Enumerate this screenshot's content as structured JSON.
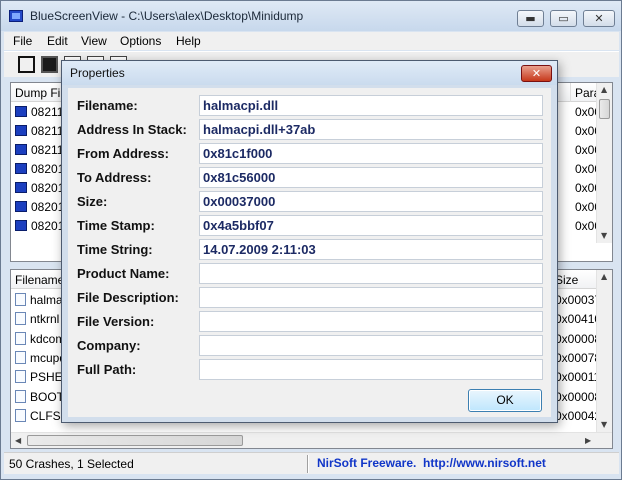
{
  "window": {
    "title": "BlueScreenView  -  C:\\Users\\alex\\Desktop\\Minidump",
    "min_label": "▬",
    "max_label": "▭",
    "close_label": "✕"
  },
  "menu": [
    "File",
    "Edit",
    "View",
    "Options",
    "Help"
  ],
  "upper_list": {
    "headers": [
      "Dump Fil",
      "Para"
    ],
    "rows": [
      {
        "name": "082112",
        "param": "0x00"
      },
      {
        "name": "082112",
        "param": "0x00"
      },
      {
        "name": "082112",
        "param": "0x00"
      },
      {
        "name": "082012",
        "param": "0x00"
      },
      {
        "name": "082012",
        "param": "0x00"
      },
      {
        "name": "082012",
        "param": "0x00"
      },
      {
        "name": "082012",
        "param": "0x00"
      }
    ]
  },
  "lower_list": {
    "headers": [
      "Filename",
      "Size"
    ],
    "rows": [
      {
        "name": "halma",
        "size": "0x000370"
      },
      {
        "name": "ntkrnl",
        "size": "0x00410"
      },
      {
        "name": "kdcom",
        "size": "0x000080"
      },
      {
        "name": "mcupd",
        "size": "0x00078"
      },
      {
        "name": "PSHED",
        "size": "0x00011"
      },
      {
        "name": "BOOT",
        "size": "0x00008"
      },
      {
        "name": "CLFS.S",
        "size": "0x00042"
      }
    ]
  },
  "statusbar": {
    "text": "50 Crashes, 1 Selected",
    "link": "NirSoft Freeware.  http://www.nirsoft.net"
  },
  "dialog": {
    "title": "Properties",
    "close_label": "✕",
    "fields": [
      {
        "label": "Filename:",
        "value": "halmacpi.dll"
      },
      {
        "label": "Address In Stack:",
        "value": "halmacpi.dll+37ab"
      },
      {
        "label": "From Address:",
        "value": "0x81c1f000"
      },
      {
        "label": "To Address:",
        "value": "0x81c56000"
      },
      {
        "label": "Size:",
        "value": "0x00037000"
      },
      {
        "label": "Time Stamp:",
        "value": "0x4a5bbf07"
      },
      {
        "label": "Time String:",
        "value": "14.07.2009 2:11:03"
      },
      {
        "label": "Product Name:",
        "value": ""
      },
      {
        "label": "File Description:",
        "value": ""
      },
      {
        "label": "File Version:",
        "value": ""
      },
      {
        "label": "Company:",
        "value": ""
      },
      {
        "label": "Full Path:",
        "value": ""
      }
    ],
    "ok_label": "OK"
  }
}
